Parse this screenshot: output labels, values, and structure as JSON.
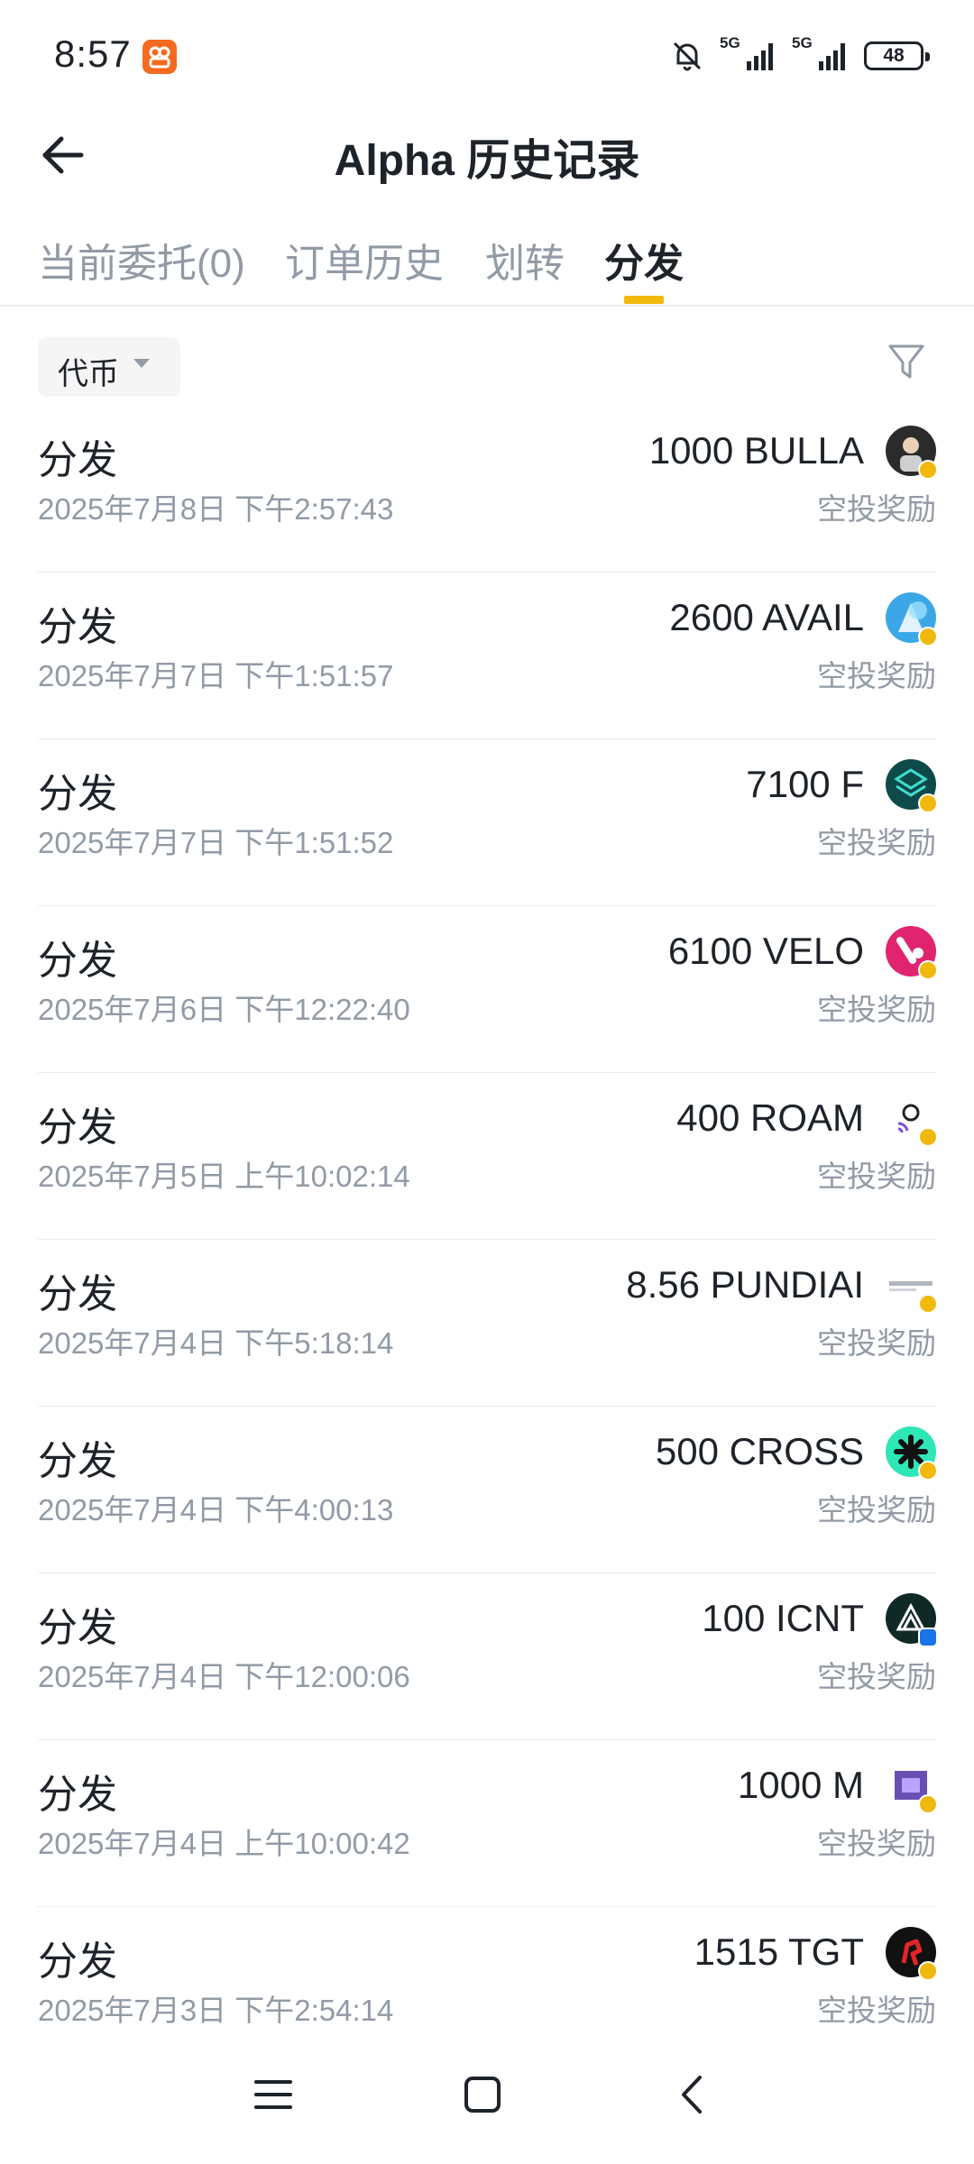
{
  "status_bar": {
    "time": "8:57",
    "network1": "5G",
    "network2": "5G",
    "battery": "48"
  },
  "header": {
    "title": "Alpha 历史记录"
  },
  "tabs": [
    {
      "label": "当前委托(0)",
      "active": false
    },
    {
      "label": "订单历史",
      "active": false
    },
    {
      "label": "划转",
      "active": false
    },
    {
      "label": "分发",
      "active": true
    }
  ],
  "filter": {
    "token_label": "代币"
  },
  "records": [
    {
      "type": "分发",
      "time": "2025年7月8日 下午2:57:43",
      "amount": "1000 BULLA",
      "sub": "空投奖励",
      "coin_color": "#2b2b2b"
    },
    {
      "type": "分发",
      "time": "2025年7月7日 下午1:51:57",
      "amount": "2600 AVAIL",
      "sub": "空投奖励",
      "coin_color": "#3ca7e6"
    },
    {
      "type": "分发",
      "time": "2025年7月7日 下午1:51:52",
      "amount": "7100 F",
      "sub": "空投奖励",
      "coin_color": "#0e4a4a"
    },
    {
      "type": "分发",
      "time": "2025年7月6日 下午12:22:40",
      "amount": "6100 VELO",
      "sub": "空投奖励",
      "coin_color": "#e0246f"
    },
    {
      "type": "分发",
      "time": "2025年7月5日 上午10:02:14",
      "amount": "400 ROAM",
      "sub": "空投奖励",
      "coin_color": "#ffffff"
    },
    {
      "type": "分发",
      "time": "2025年7月4日 下午5:18:14",
      "amount": "8.56 PUNDIAI",
      "sub": "空投奖励",
      "coin_color": "#ffffff"
    },
    {
      "type": "分发",
      "time": "2025年7月4日 下午4:00:13",
      "amount": "500 CROSS",
      "sub": "空投奖励",
      "coin_color": "#2ee6b6"
    },
    {
      "type": "分发",
      "time": "2025年7月4日 下午12:00:06",
      "amount": "100 ICNT",
      "sub": "空投奖励",
      "coin_color": "#0f2a26"
    },
    {
      "type": "分发",
      "time": "2025年7月4日 上午10:00:42",
      "amount": "1000 M",
      "sub": "空投奖励",
      "coin_color": "#6a4fb3"
    },
    {
      "type": "分发",
      "time": "2025年7月3日 下午2:54:14",
      "amount": "1515 TGT",
      "sub": "空投奖励",
      "coin_color": "#111111"
    }
  ],
  "colors": {
    "accent": "#f0b90b",
    "text_primary": "#1e2329",
    "text_secondary": "#929aa5"
  }
}
